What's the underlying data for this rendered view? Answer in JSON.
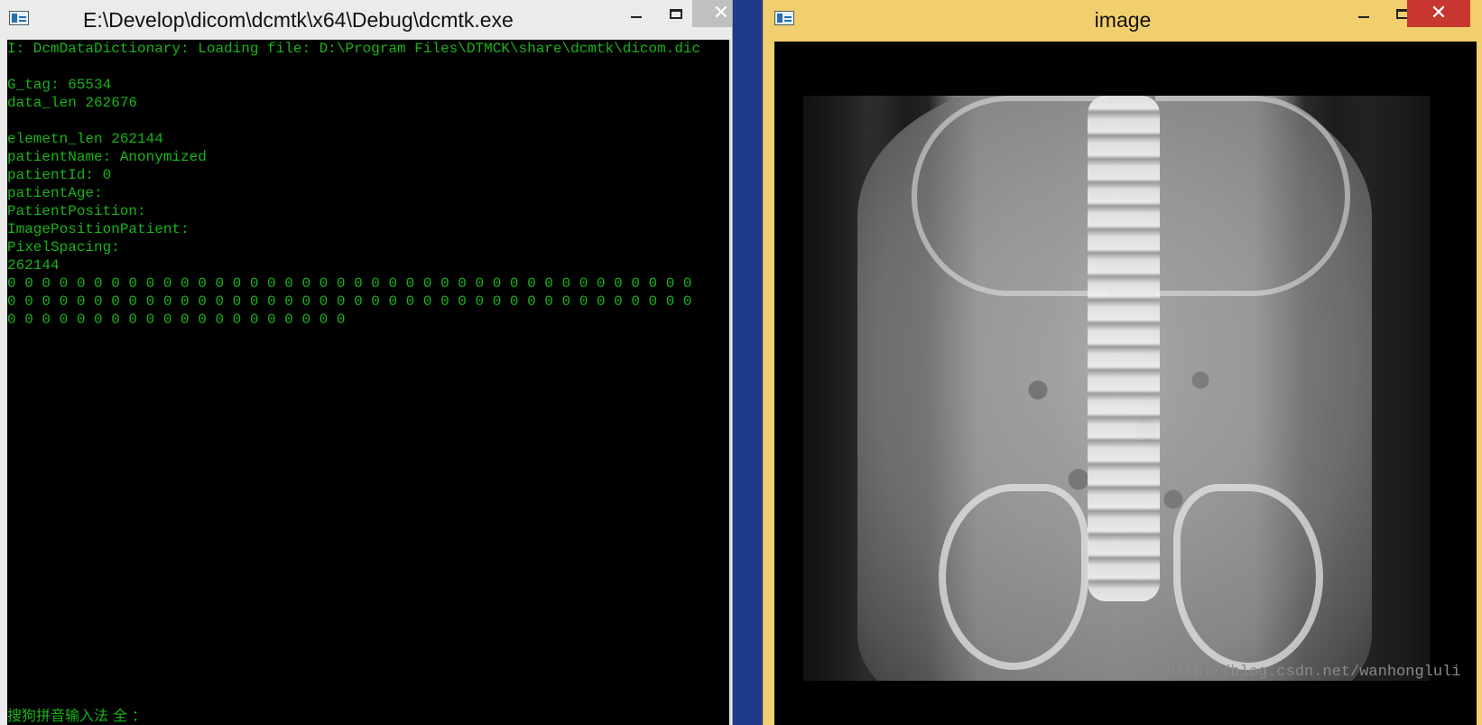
{
  "console": {
    "title": "E:\\Develop\\dicom\\dcmtk\\x64\\Debug\\dcmtk.exe",
    "lines": [
      "I: DcmDataDictionary: Loading file: D:\\Program Files\\DTMCK\\share\\dcmtk\\dicom.dic",
      "",
      "G_tag: 65534",
      "data_len 262676",
      "",
      "elemetn_len 262144",
      "patientName: Anonymized",
      "patientId: 0",
      "patientAge:",
      "PatientPosition:",
      "ImagePositionPatient:",
      "PixelSpacing:",
      "262144",
      "0 0 0 0 0 0 0 0 0 0 0 0 0 0 0 0 0 0 0 0 0 0 0 0 0 0 0 0 0 0 0 0 0 0 0 0 0 0 0 0",
      "0 0 0 0 0 0 0 0 0 0 0 0 0 0 0 0 0 0 0 0 0 0 0 0 0 0 0 0 0 0 0 0 0 0 0 0 0 0 0 0",
      "0 0 0 0 0 0 0 0 0 0 0 0 0 0 0 0 0 0 0 0"
    ],
    "ime_status": "搜狗拼音输入法 全 ：",
    "text_color": "#18b418"
  },
  "image_window": {
    "title": "image",
    "watermark": "http://blog.csdn.net/wanhongluli",
    "titlebar_color": "#f1cf6e"
  },
  "controls": {
    "minimize_glyph": "—",
    "maximize_glyph": "□",
    "close_glyph": "✕"
  }
}
